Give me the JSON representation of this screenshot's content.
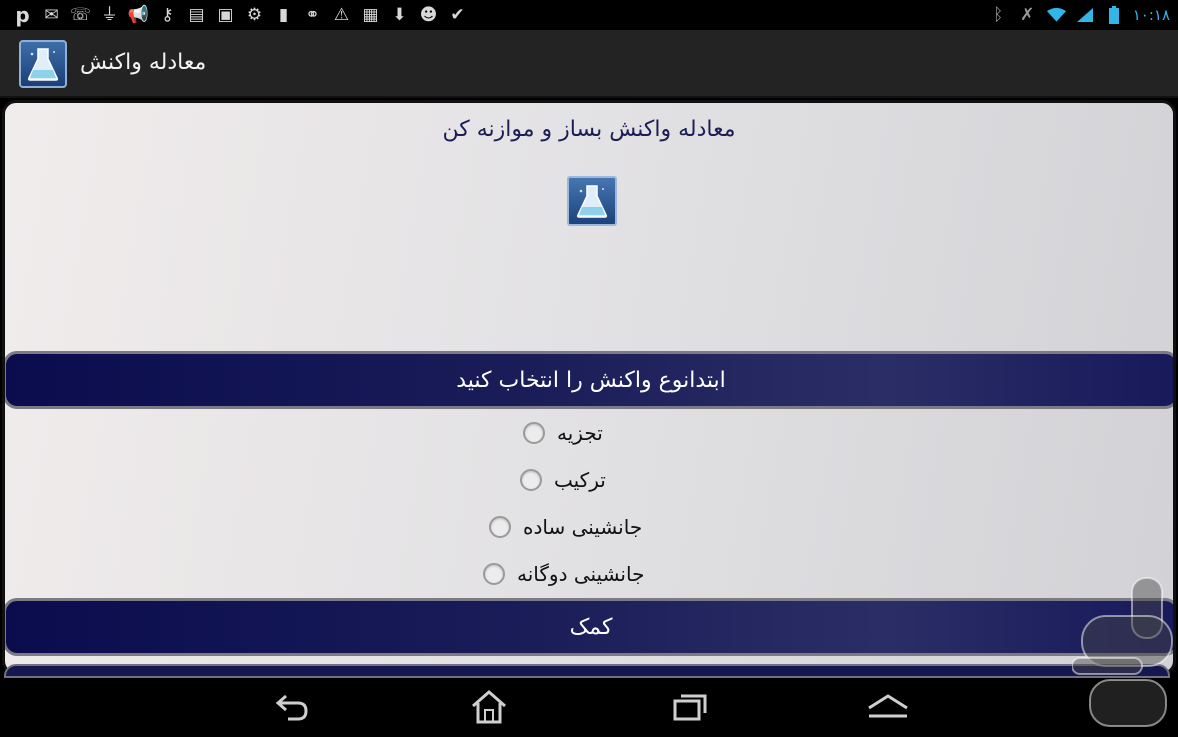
{
  "status_bar": {
    "time": "۱۰:۱۸",
    "left_icons": [
      "pinterest-icon",
      "mail-icon",
      "chat-icon",
      "usb-icon",
      "megaphone-icon",
      "key-icon",
      "message-icon",
      "image-icon",
      "android-debug-icon",
      "sd-card-icon",
      "link-icon",
      "warning-icon",
      "store-icon",
      "download-icon",
      "android-icon",
      "clipboard-icon"
    ],
    "right_icons": [
      "bluetooth-icon",
      "mute-icon",
      "wifi-icon",
      "signal-icon",
      "battery-icon"
    ]
  },
  "action_bar": {
    "title": "معادله واکنش",
    "icon": "flask-icon"
  },
  "main": {
    "heading": "معادله واکنش بساز و موازنه کن",
    "center_icon": "flask-icon",
    "section_header": "ابتدانوع واکنش  را انتخاب کنید",
    "options": [
      {
        "label": "تجزیه"
      },
      {
        "label": "ترکیب"
      },
      {
        "label": "جانشینی ساده"
      },
      {
        "label": "جانشینی دوگانه"
      }
    ],
    "help_button": "کمک"
  },
  "nav_bar": {
    "buttons": [
      "back-icon",
      "home-icon",
      "recents-icon",
      "menu-up-icon"
    ]
  },
  "colors": {
    "navy": "#0a0c4e",
    "accent_blue": "#33b5e5",
    "title_text": "#1b1e55"
  }
}
